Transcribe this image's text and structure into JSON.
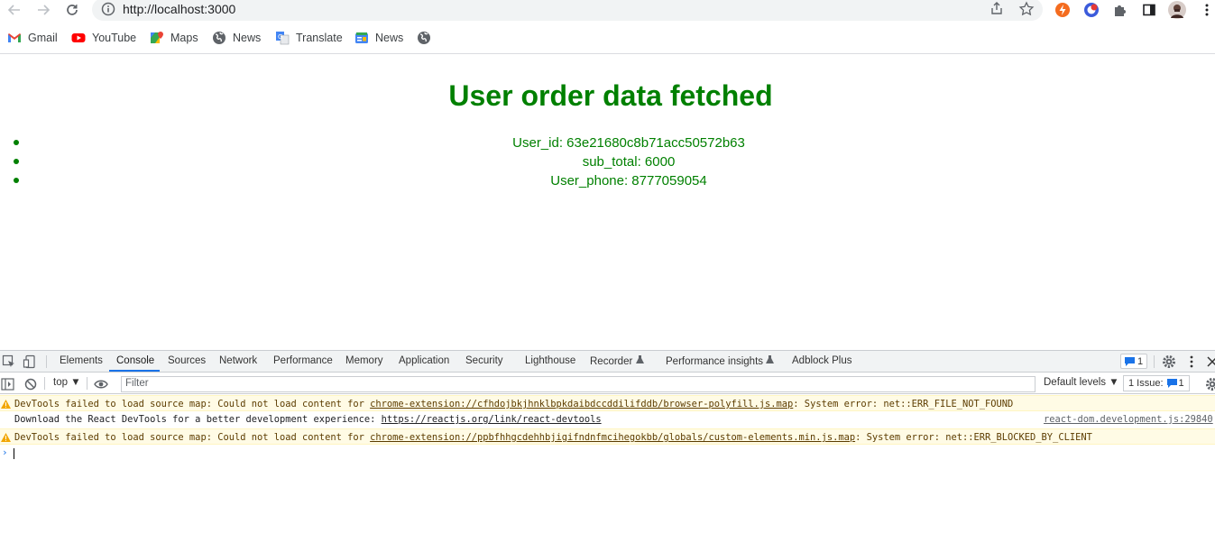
{
  "browser": {
    "url": "http://localhost:3000",
    "nav_icons": [
      "back-icon",
      "forward-icon",
      "reload-icon"
    ],
    "omnibox_icons": [
      "info-icon",
      "share-icon",
      "star-icon"
    ],
    "extension_icons": [
      "lightning-extension-icon",
      "chrome-extension-icon",
      "puzzle-icon",
      "side-panel-icon",
      "profile-avatar",
      "menu-icon"
    ]
  },
  "bookmarks": [
    {
      "label": "Gmail",
      "icon": "gmail-icon"
    },
    {
      "label": "YouTube",
      "icon": "youtube-icon"
    },
    {
      "label": "Maps",
      "icon": "maps-icon"
    },
    {
      "label": "News",
      "icon": "globe-icon"
    },
    {
      "label": "Translate",
      "icon": "translate-icon"
    },
    {
      "label": "News",
      "icon": "news-icon"
    },
    {
      "label": "",
      "icon": "globe-icon"
    }
  ],
  "page": {
    "title": "User order data fetched",
    "items": [
      "User_id: 63e21680c8b71acc50572b63",
      "sub_total: 6000",
      "User_phone: 8777059054"
    ],
    "accent_color": "#008000"
  },
  "devtools": {
    "tabs": [
      "Elements",
      "Console",
      "Sources",
      "Network",
      "Performance",
      "Memory",
      "Application",
      "Security",
      "Lighthouse",
      "Recorder",
      "Performance insights",
      "Adblock Plus"
    ],
    "active_tab": "Console",
    "message_badge": "1",
    "context": "top",
    "filter_placeholder": "Filter",
    "levels": "Default levels",
    "issues_label": "1 Issue:",
    "issues_count": "1",
    "messages": [
      {
        "level": "warning",
        "prefix": "DevTools failed to load source map: Could not load content for ",
        "link": "chrome-extension://cfhdojbkjhnklbpkdaibdccddilifddb/browser-polyfill.js.map",
        "suffix": ": System error: net::ERR_FILE_NOT_FOUND"
      },
      {
        "level": "info",
        "prefix": "Download the React DevTools for a better development experience: ",
        "link": "https://reactjs.org/link/react-devtools",
        "suffix": "",
        "source": "react-dom.development.js:29840"
      },
      {
        "level": "warning",
        "prefix": "DevTools failed to load source map: Could not load content for ",
        "link": "chrome-extension://ppbfhhgcdehhbjigifndnfmcihegokbb/globals/custom-elements.min.js.map",
        "suffix": ": System error: net::ERR_BLOCKED_BY_CLIENT"
      }
    ],
    "prompt_symbol": "›"
  }
}
